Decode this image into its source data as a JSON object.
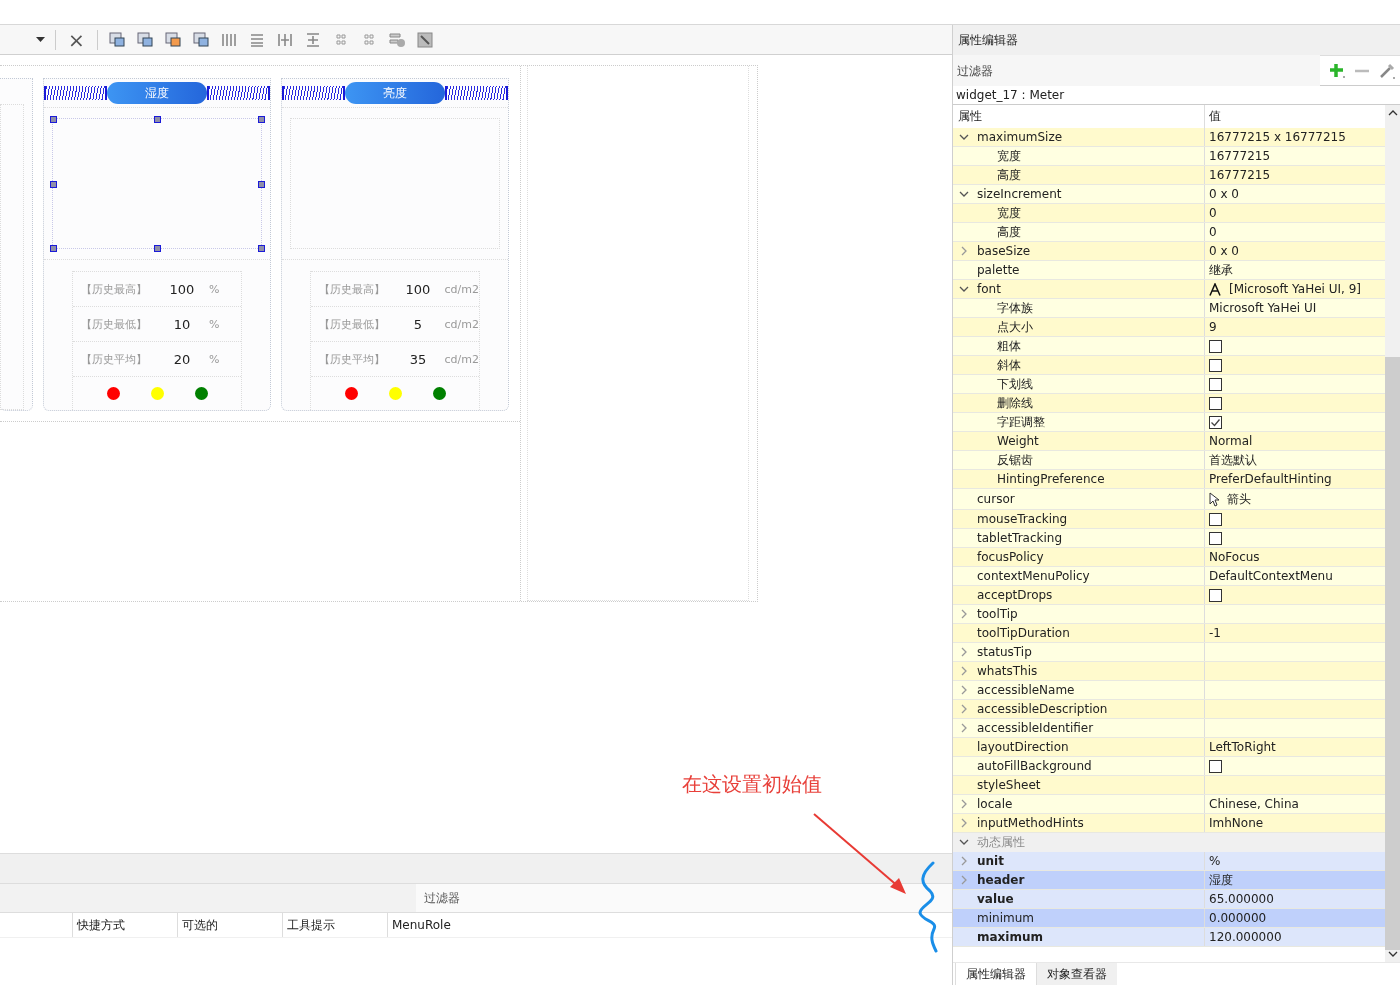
{
  "toolbar": {
    "close_label": "×"
  },
  "canvas": {
    "cards": [
      {
        "header": "湿度",
        "selected": true,
        "stats": [
          {
            "label": "【历史最高】",
            "value": "100",
            "unit": "%"
          },
          {
            "label": "【历史最低】",
            "value": "10",
            "unit": "%"
          },
          {
            "label": "【历史平均】",
            "value": "20",
            "unit": "%"
          }
        ],
        "lights": [
          {
            "color": "#ff0000"
          },
          {
            "color": "#ffff00"
          },
          {
            "color": "#008000"
          }
        ]
      },
      {
        "header": "亮度",
        "selected": false,
        "stats": [
          {
            "label": "【历史最高】",
            "value": "100",
            "unit": "cd/m2"
          },
          {
            "label": "【历史最低】",
            "value": "5",
            "unit": "cd/m2"
          },
          {
            "label": "【历史平均】",
            "value": "35",
            "unit": "cd/m2"
          }
        ],
        "lights": [
          {
            "color": "#ff0000"
          },
          {
            "color": "#ffff00"
          },
          {
            "color": "#008000"
          }
        ]
      }
    ],
    "annotation": "在这设置初始值"
  },
  "action_editor": {
    "filter": {
      "placeholder": "过滤器"
    },
    "columns": [
      "快捷方式",
      "可选的",
      "工具提示",
      "MenuRole"
    ]
  },
  "property_editor": {
    "title": "属性编辑器",
    "filter": {
      "placeholder": "过滤器"
    },
    "object_label": "widget_17 : Meter",
    "columns": [
      "属性",
      "值"
    ],
    "properties": [
      {
        "name": "maximumSize",
        "kind": "text",
        "value": "16777215 x 16777215",
        "expanded": true,
        "children": [
          {
            "name": "宽度",
            "kind": "text",
            "value": "16777215"
          },
          {
            "name": "高度",
            "kind": "text",
            "value": "16777215"
          }
        ]
      },
      {
        "name": "sizeIncrement",
        "kind": "text",
        "value": "0 x 0",
        "expanded": true,
        "children": [
          {
            "name": "宽度",
            "kind": "text",
            "value": "0"
          },
          {
            "name": "高度",
            "kind": "text",
            "value": "0"
          }
        ]
      },
      {
        "name": "baseSize",
        "kind": "text",
        "value": "0 x 0",
        "expanded": false
      },
      {
        "name": "palette",
        "kind": "text",
        "value": "继承"
      },
      {
        "name": "font",
        "kind": "font",
        "value": "[Microsoft YaHei UI, 9]",
        "expanded": true,
        "children": [
          {
            "name": "字体族",
            "kind": "text",
            "value": "Microsoft YaHei UI"
          },
          {
            "name": "点大小",
            "kind": "text",
            "value": "9"
          },
          {
            "name": "粗体",
            "kind": "checkbox",
            "checked": false
          },
          {
            "name": "斜体",
            "kind": "checkbox",
            "checked": false
          },
          {
            "name": "下划线",
            "kind": "checkbox",
            "checked": false
          },
          {
            "name": "删除线",
            "kind": "checkbox",
            "checked": false
          },
          {
            "name": "字距调整",
            "kind": "checkbox",
            "checked": true
          },
          {
            "name": "Weight",
            "kind": "text",
            "value": "Normal"
          },
          {
            "name": "反锯齿",
            "kind": "text",
            "value": "首选默认"
          },
          {
            "name": "HintingPreference",
            "kind": "text",
            "value": "PreferDefaultHinting"
          }
        ]
      },
      {
        "name": "cursor",
        "kind": "cursor",
        "value": "箭头"
      },
      {
        "name": "mouseTracking",
        "kind": "checkbox",
        "checked": false
      },
      {
        "name": "tabletTracking",
        "kind": "checkbox",
        "checked": false
      },
      {
        "name": "focusPolicy",
        "kind": "text",
        "value": "NoFocus"
      },
      {
        "name": "contextMenuPolicy",
        "kind": "text",
        "value": "DefaultContextMenu"
      },
      {
        "name": "acceptDrops",
        "kind": "checkbox",
        "checked": false
      },
      {
        "name": "toolTip",
        "kind": "text",
        "expanded": false
      },
      {
        "name": "toolTipDuration",
        "kind": "text",
        "value": "-1"
      },
      {
        "name": "statusTip",
        "kind": "text",
        "expanded": false
      },
      {
        "name": "whatsThis",
        "kind": "text",
        "expanded": false
      },
      {
        "name": "accessibleName",
        "kind": "text",
        "expanded": false
      },
      {
        "name": "accessibleDescription",
        "kind": "text",
        "expanded": false
      },
      {
        "name": "accessibleIdentifier",
        "kind": "text",
        "expanded": false
      },
      {
        "name": "layoutDirection",
        "kind": "text",
        "value": "LeftToRight"
      },
      {
        "name": "autoFillBackground",
        "kind": "checkbox",
        "checked": false
      },
      {
        "name": "styleSheet",
        "kind": "text"
      },
      {
        "name": "locale",
        "kind": "text",
        "value": "Chinese, China",
        "expanded": false
      },
      {
        "name": "inputMethodHints",
        "kind": "text",
        "value": "ImhNone",
        "expanded": false
      }
    ],
    "dynamic_section": {
      "title": "动态属性",
      "expanded": true,
      "properties": [
        {
          "name": "unit",
          "kind": "text",
          "value": "%",
          "expanded": false,
          "modified": true
        },
        {
          "name": "header",
          "kind": "text",
          "value": "湿度",
          "expanded": false,
          "modified": true
        },
        {
          "name": "value",
          "kind": "text",
          "value": "65.000000",
          "modified": true
        },
        {
          "name": "minimum",
          "kind": "text",
          "value": "0.000000",
          "modified": false
        },
        {
          "name": "maximum",
          "kind": "text",
          "value": "120.000000",
          "modified": true
        }
      ]
    },
    "tabs": [
      {
        "label": "属性编辑器",
        "selected": true
      },
      {
        "label": "对象查看器",
        "selected": false
      }
    ]
  }
}
